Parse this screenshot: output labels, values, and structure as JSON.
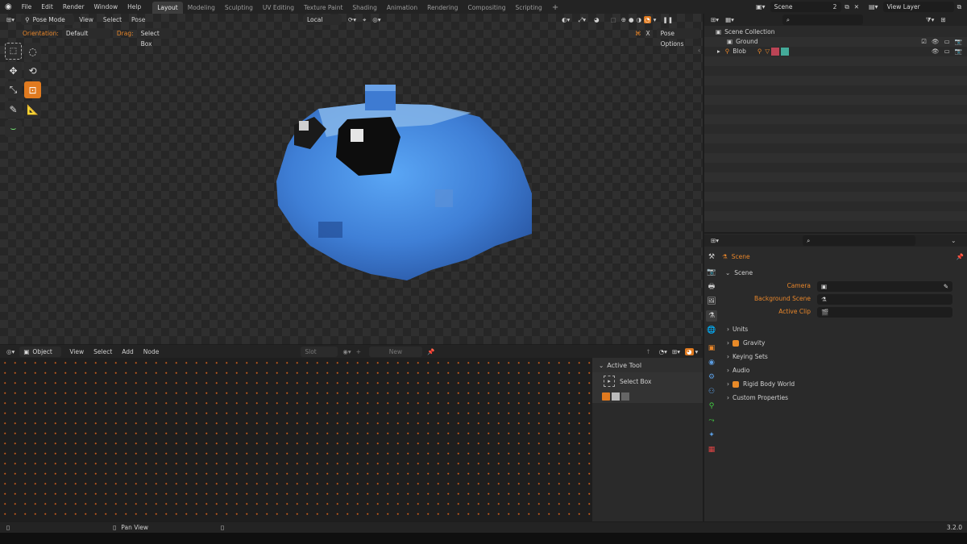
{
  "topbar": {
    "menus": [
      "File",
      "Edit",
      "Render",
      "Window",
      "Help"
    ],
    "workspaces": [
      "Layout",
      "Modeling",
      "Sculpting",
      "UV Editing",
      "Texture Paint",
      "Shading",
      "Animation",
      "Rendering",
      "Compositing",
      "Scripting"
    ],
    "active_workspace": "Layout",
    "add_tab": "+",
    "scene_name": "Scene",
    "scene_count": "2",
    "view_layer": "View Layer"
  },
  "viewport": {
    "mode": "Pose Mode",
    "menus": [
      "View",
      "Select",
      "Pose"
    ],
    "orientation_transform": "Local",
    "orientation_label": "Orientation:",
    "orientation_value": "Default",
    "drag_label": "Drag:",
    "drag_value": "Select Box",
    "pose_options": "Pose Options",
    "x_axis": "X"
  },
  "node_editor": {
    "type": "Object",
    "menus": [
      "View",
      "Select",
      "Add",
      "Node"
    ],
    "slot": "Slot",
    "new_button": "New"
  },
  "active_tool_panel": {
    "title": "Active Tool",
    "tool_name": "Select Box"
  },
  "outliner": {
    "root": "Scene Collection",
    "items": [
      "Ground",
      "Blob"
    ]
  },
  "properties": {
    "context": "Scene",
    "section": "Scene",
    "fields": [
      "Camera",
      "Background Scene",
      "Active Clip"
    ],
    "panels": [
      {
        "label": "Units",
        "checkbox": false
      },
      {
        "label": "Gravity",
        "checkbox": true
      },
      {
        "label": "Keying Sets",
        "checkbox": false
      },
      {
        "label": "Audio",
        "checkbox": false
      },
      {
        "label": "Rigid Body World",
        "checkbox": true
      },
      {
        "label": "Custom Properties",
        "checkbox": false
      }
    ]
  },
  "statusbar": {
    "pan_view": "Pan View",
    "version": "3.2.0"
  },
  "colors": {
    "accent": "#e8862a",
    "active_tool": "#e07a1f",
    "blob": "#4a8fe0"
  }
}
